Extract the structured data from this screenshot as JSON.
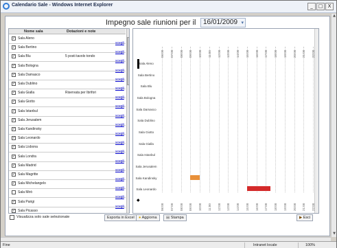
{
  "window": {
    "title": "Calendario Sale - Windows Internet Explorer",
    "minimize": "_",
    "maximize": "□",
    "close": "X"
  },
  "page": {
    "title": "Impegno sale riunioni per il",
    "date": "16/01/2009",
    "date_dropdown": "▾"
  },
  "table": {
    "col_room": "Nome sala",
    "col_notes": "Dotazioni e note",
    "link_label": "scegli",
    "rows": [
      {
        "name": "Sala Aleno",
        "notes": "",
        "checked": true
      },
      {
        "name": "Sala Bertino",
        "notes": "",
        "checked": true
      },
      {
        "name": "Sala Blu",
        "notes": "5 posti tavolo tondo",
        "checked": true
      },
      {
        "name": "Sala Bologna",
        "notes": "",
        "checked": true
      },
      {
        "name": "Sala Damasco",
        "notes": "",
        "checked": true
      },
      {
        "name": "Sala Dublino",
        "notes": "",
        "checked": true
      },
      {
        "name": "Sala Gialla",
        "notes": "Riservata per Ibrifori",
        "checked": true
      },
      {
        "name": "Sala Giotto",
        "notes": "",
        "checked": true
      },
      {
        "name": "Sala Istanbul",
        "notes": "",
        "checked": true
      },
      {
        "name": "Sala Jerusalem",
        "notes": "",
        "checked": true
      },
      {
        "name": "Sala Kandinsky",
        "notes": "",
        "checked": true
      },
      {
        "name": "Sala Leonardo",
        "notes": "",
        "checked": true
      },
      {
        "name": "Sala Lisbona",
        "notes": "",
        "checked": true
      },
      {
        "name": "Sala Londra",
        "notes": "",
        "checked": true
      },
      {
        "name": "Sala Madrid",
        "notes": "",
        "checked": true
      },
      {
        "name": "Sala Magritte",
        "notes": "",
        "checked": true
      },
      {
        "name": "Sala Michelangelo",
        "notes": "",
        "checked": true
      },
      {
        "name": "Sala Mirò",
        "notes": "",
        "checked": false
      },
      {
        "name": "Sala Parigi",
        "notes": "",
        "checked": true
      },
      {
        "name": "Sala Picasso",
        "notes": "",
        "checked": true
      }
    ]
  },
  "bottom": {
    "only_selected_label": "Visualizza solo sale selezionate",
    "only_selected_checked": false,
    "export_label": "Esporta in Excel",
    "update_label": "Aggiorna",
    "print_label": "Stampa",
    "exit_label": "Esci"
  },
  "gantt": {
    "hours": [
      "06:00",
      "07:00",
      "08:00",
      "09:00",
      "10:00",
      "11:00",
      "12:00",
      "13:00",
      "14:00",
      "15:00",
      "16:00",
      "17:00",
      "18:00",
      "19:00",
      "20:00",
      "21:00",
      "22:00"
    ],
    "rooms": [
      "Sala Aleno",
      "Sala Bertino",
      "Sala Blu",
      "Sala Bologna",
      "Sala Damasco",
      "Sala Dublino",
      "Sala Giotto",
      "Sala Gialla",
      "Sala Istanbul",
      "Sala Jerusalem",
      "Sala Kandinsky",
      "Sala Leonardo"
    ],
    "bookings": [
      {
        "room": "Sala Kandinsky",
        "start": 9.0,
        "end": 10.0,
        "color": "#e8903a"
      },
      {
        "room": "Sala Leonardo",
        "start": 15.0,
        "end": 17.5,
        "color": "#d42a2a"
      }
    ]
  },
  "status": {
    "left": "Fine",
    "zone": "Intranet locale",
    "zoom": "100%"
  }
}
